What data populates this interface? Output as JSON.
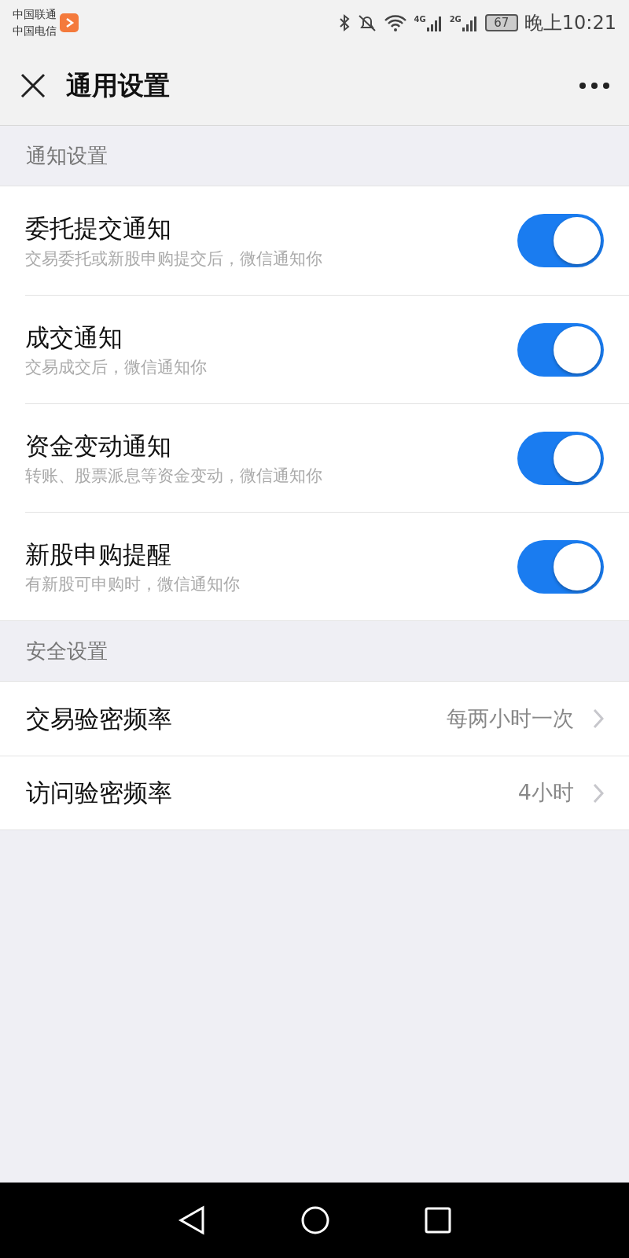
{
  "status_bar": {
    "carriers": [
      "中国联通",
      "中国电信"
    ],
    "network_labels": [
      "4G",
      "2G"
    ],
    "battery": "67",
    "time": "晚上10:21"
  },
  "header": {
    "title": "通用设置"
  },
  "sections": [
    {
      "title": "通知设置",
      "items": [
        {
          "kind": "toggle",
          "label": "委托提交通知",
          "description": "交易委托或新股申购提交后，微信通知你",
          "on": true
        },
        {
          "kind": "toggle",
          "label": "成交通知",
          "description": "交易成交后，微信通知你",
          "on": true
        },
        {
          "kind": "toggle",
          "label": "资金变动通知",
          "description": "转账、股票派息等资金变动，微信通知你",
          "on": true
        },
        {
          "kind": "toggle",
          "label": "新股申购提醒",
          "description": "有新股可申购时，微信通知你",
          "on": true
        }
      ]
    },
    {
      "title": "安全设置",
      "items": [
        {
          "kind": "link",
          "label": "交易验密频率",
          "value": "每两小时一次"
        },
        {
          "kind": "link",
          "label": "访问验密频率",
          "value": "4小时"
        }
      ]
    }
  ]
}
